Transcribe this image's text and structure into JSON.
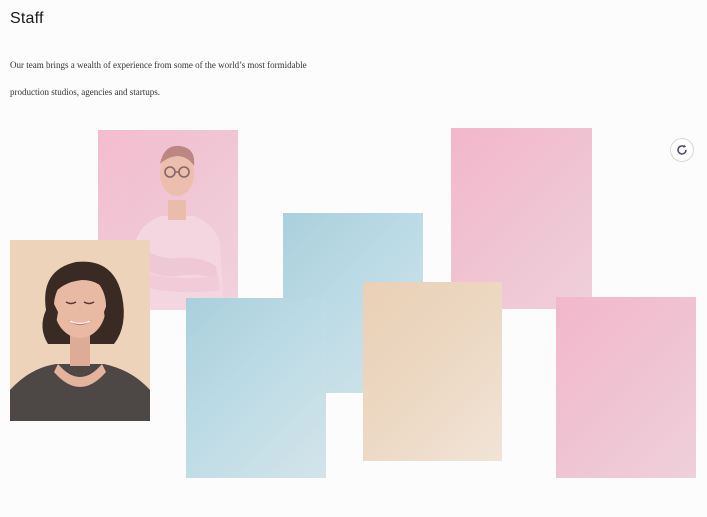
{
  "page": {
    "title": "Staff",
    "description": "Our team brings a wealth of experience from some of the world’s most formidable production studios, agencies and startups."
  },
  "controls": {
    "refresh_icon": "refresh-icon"
  },
  "cards": [
    {
      "name": "staff-card-man-glasses",
      "color": "pink",
      "photo": "man-with-glasses"
    },
    {
      "name": "staff-card-woman-smiling",
      "color": "peach",
      "photo": "woman-smiling"
    },
    {
      "name": "staff-card-blue-top",
      "color": "blue",
      "photo": null
    },
    {
      "name": "staff-card-blue-bottom",
      "color": "blue",
      "photo": null
    },
    {
      "name": "staff-card-peach-center",
      "color": "peach",
      "photo": null
    },
    {
      "name": "staff-card-pink-top-right",
      "color": "pink",
      "photo": null
    },
    {
      "name": "staff-card-pink-bottom-right",
      "color": "pink",
      "photo": null
    }
  ],
  "colors": {
    "pink": "#f3b7cb",
    "blue": "#a9d0dd",
    "peach": "#ead0b6"
  }
}
